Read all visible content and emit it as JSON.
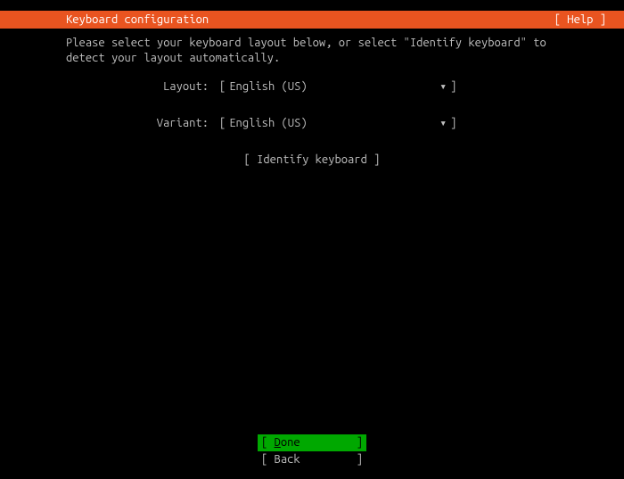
{
  "header": {
    "title": "Keyboard configuration",
    "help_label": "[ Help ]"
  },
  "instruction": "Please select your keyboard layout below, or select \"Identify keyboard\" to detect your layout automatically.",
  "form": {
    "layout": {
      "label": "Layout:",
      "value": "English (US)"
    },
    "variant": {
      "label": "Variant:",
      "value": "English (US)"
    }
  },
  "identify_button": "[ Identify keyboard ]",
  "buttons": {
    "done_bracket_l": "[ ",
    "done_first_char": "D",
    "done_rest": "one",
    "done_bracket_r": "]",
    "back_bracket_l": "[ ",
    "back_text": "Back",
    "back_bracket_r": "]"
  },
  "glyphs": {
    "arrow_down": "▾",
    "bracket_l": "[",
    "bracket_r": "]"
  }
}
